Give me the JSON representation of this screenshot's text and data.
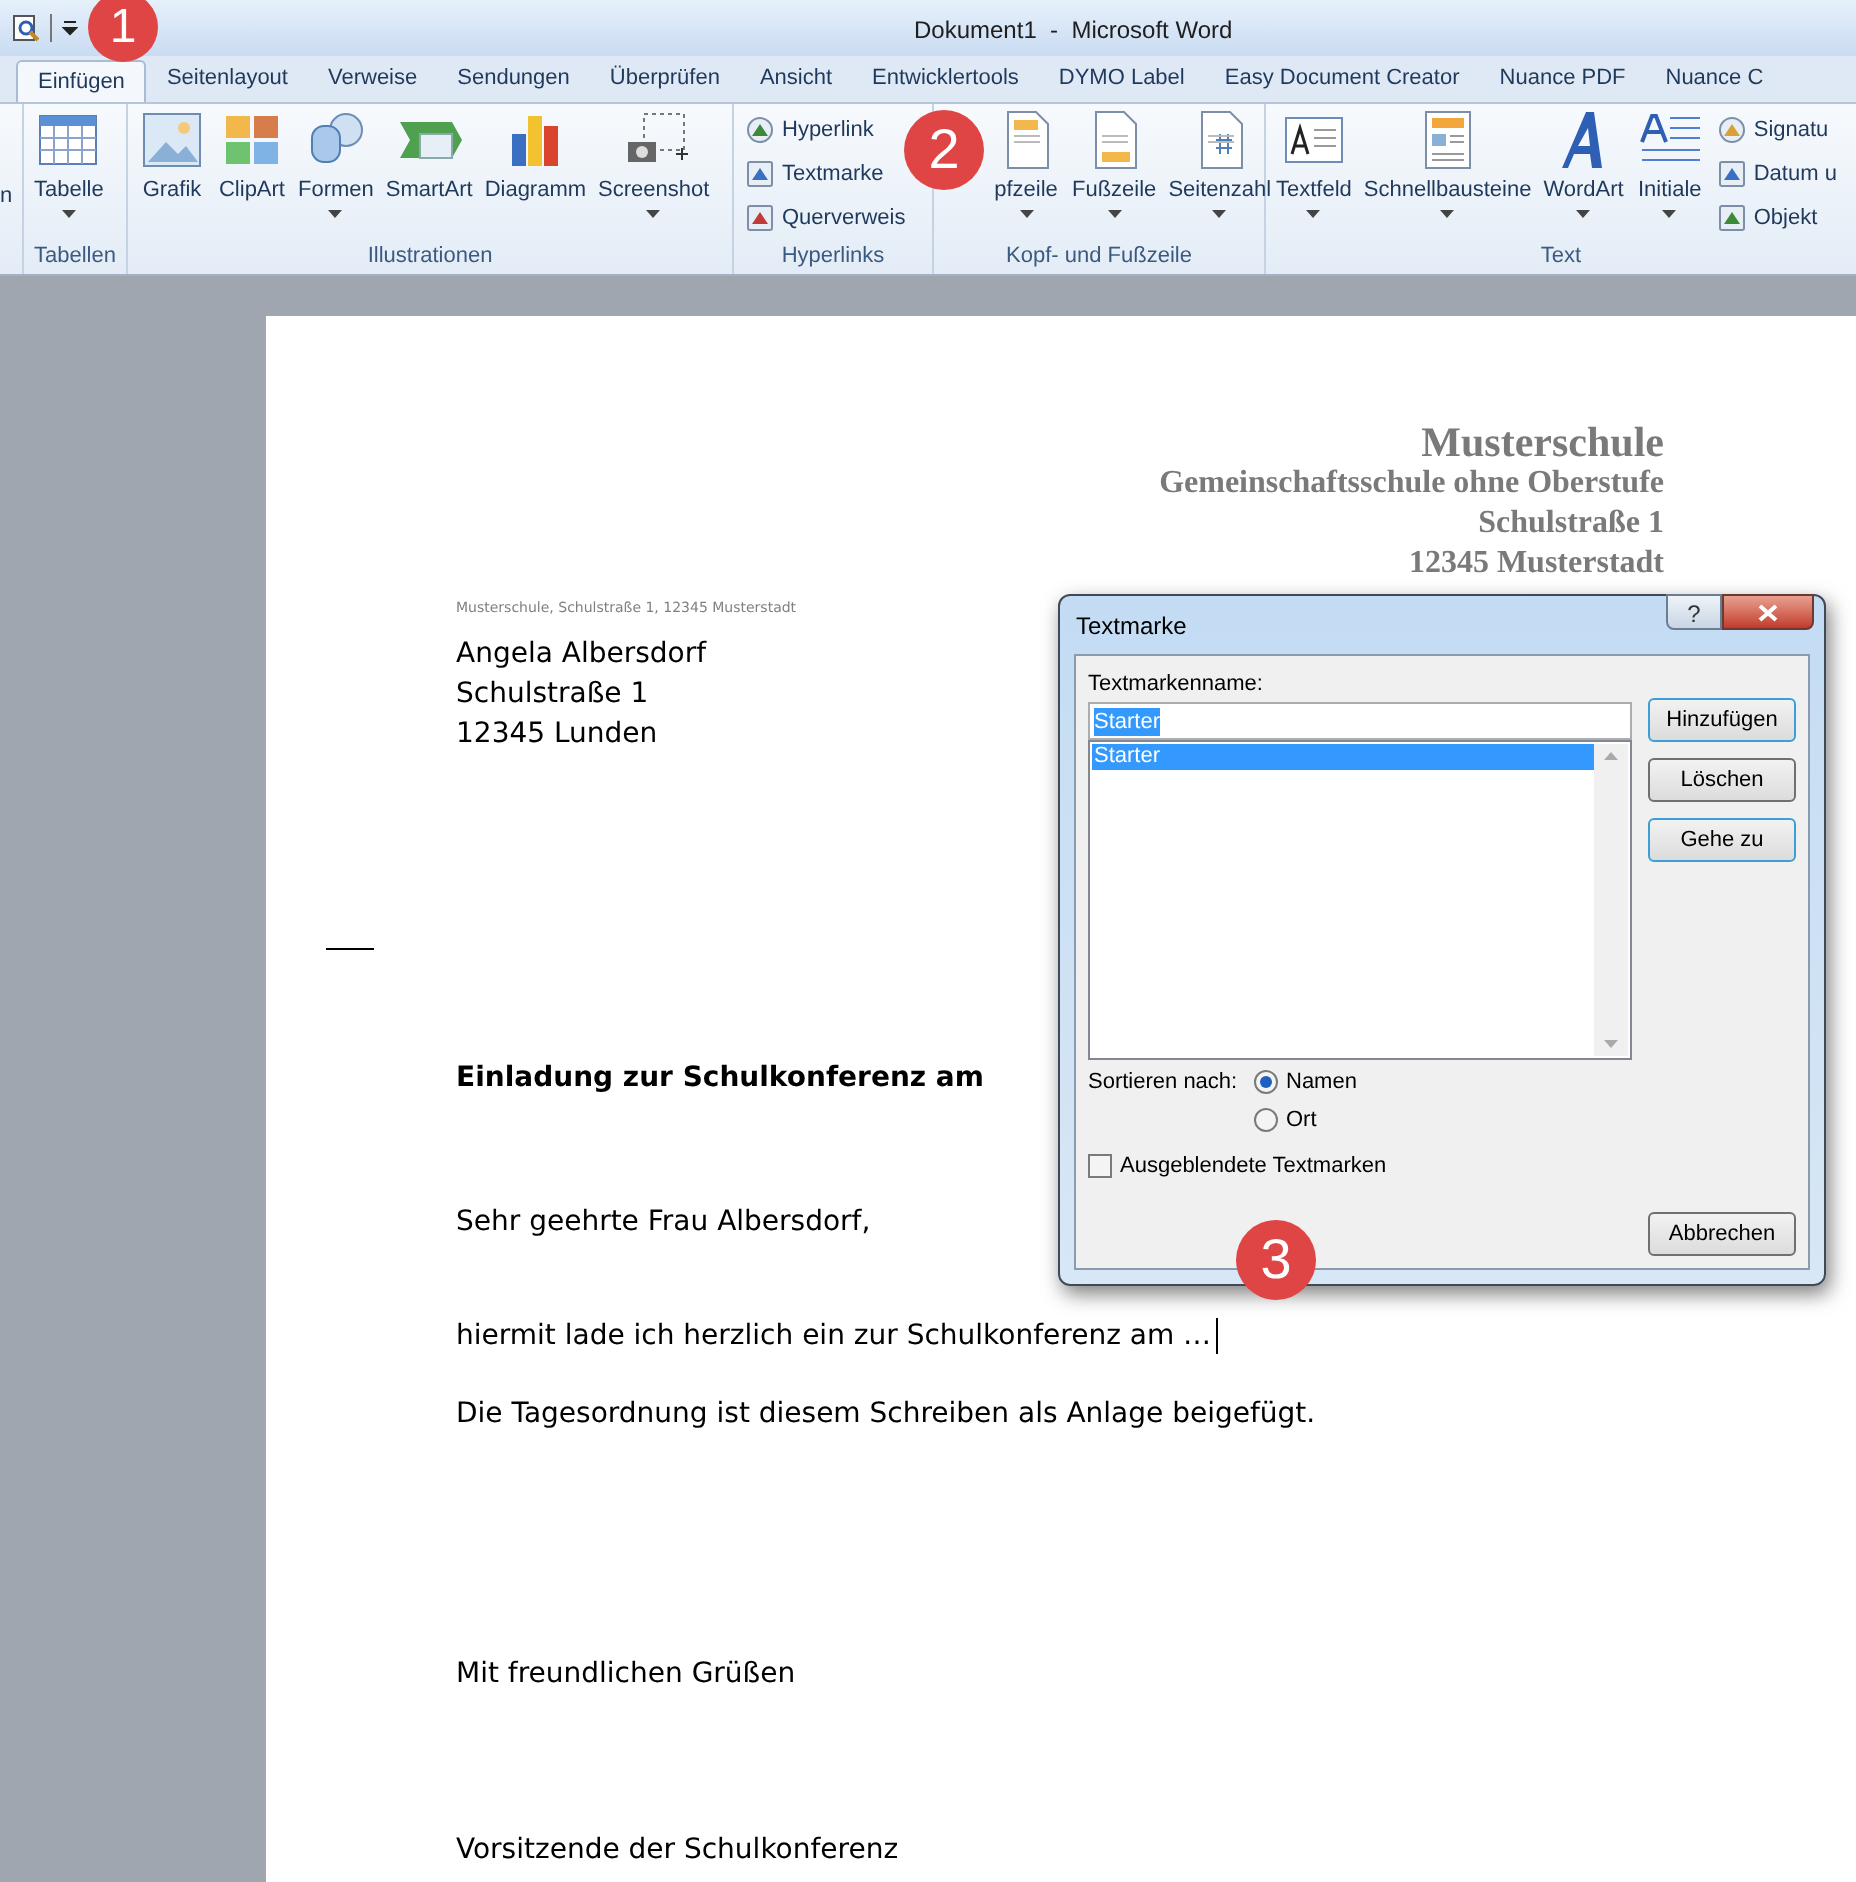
{
  "window": {
    "title": "Dokument1  -  Microsoft Word"
  },
  "tabs": [
    {
      "label": "Einfügen",
      "selected": true
    },
    {
      "label": "Seitenlayout",
      "selected": false
    },
    {
      "label": "Verweise",
      "selected": false
    },
    {
      "label": "Sendungen",
      "selected": false
    },
    {
      "label": "Überprüfen",
      "selected": false
    },
    {
      "label": "Ansicht",
      "selected": false
    },
    {
      "label": "Entwicklertools",
      "selected": false
    },
    {
      "label": "DYMO Label",
      "selected": false
    },
    {
      "label": "Easy Document Creator",
      "selected": false
    },
    {
      "label": "Nuance PDF",
      "selected": false
    },
    {
      "label": "Nuance C",
      "selected": false
    }
  ],
  "ribbon": {
    "cut_label": "n",
    "groups": [
      {
        "label": "Tabellen",
        "items": [
          {
            "kind": "large",
            "label": "Tabelle",
            "dropdown": true
          }
        ]
      },
      {
        "label": "Illustrationen",
        "items": [
          {
            "kind": "large",
            "label": "Grafik",
            "dropdown": false
          },
          {
            "kind": "large",
            "label": "ClipArt",
            "dropdown": false
          },
          {
            "kind": "large",
            "label": "Formen",
            "dropdown": true
          },
          {
            "kind": "large",
            "label": "SmartArt",
            "dropdown": false
          },
          {
            "kind": "large",
            "label": "Diagramm",
            "dropdown": false
          },
          {
            "kind": "large",
            "label": "Screenshot",
            "dropdown": true
          }
        ]
      },
      {
        "label": "Hyperlinks",
        "items": [
          {
            "kind": "stack",
            "labels": [
              "Hyperlink",
              "Textmarke",
              "Querverweis"
            ]
          }
        ]
      },
      {
        "label": "Kopf- und Fußzeile",
        "items": [
          {
            "kind": "large",
            "label": "pfzeile",
            "dropdown": true
          },
          {
            "kind": "large",
            "label": "Fußzeile",
            "dropdown": true
          },
          {
            "kind": "large",
            "label": "Seitenzahl",
            "dropdown": true
          }
        ]
      },
      {
        "label": "Text",
        "items": [
          {
            "kind": "large",
            "label": "Textfeld",
            "dropdown": true
          },
          {
            "kind": "large",
            "label": "Schnellbausteine",
            "dropdown": true
          },
          {
            "kind": "large",
            "label": "WordArt",
            "dropdown": true
          },
          {
            "kind": "large",
            "label": "Initiale",
            "dropdown": true
          },
          {
            "kind": "stack",
            "labels": [
              "Signatu",
              "Datum u",
              "Objekt"
            ]
          }
        ]
      }
    ]
  },
  "document": {
    "letterhead": [
      "Musterschule",
      "Gemeinschaftsschule ohne Oberstufe",
      "Schulstraße 1",
      "12345 Musterstadt"
    ],
    "sender_line": "Musterschule, Schulstraße 1, 12345 Musterstadt",
    "address": [
      "Angela Albersdorf",
      "Schulstraße 1",
      "12345 Lunden"
    ],
    "subject": "Einladung zur Schulkonferenz am",
    "greeting": "Sehr geehrte Frau Albersdorf,",
    "paragraphs": [
      "hiermit lade ich herzlich ein zur Schulkonferenz am …",
      "Die Tagesordnung ist diesem Schreiben als Anlage beigefügt."
    ],
    "closing": "Mit freundlichen Grüßen",
    "signature": "Vorsitzende der Schulkonferenz"
  },
  "dialog": {
    "title": "Textmarke",
    "help": "?",
    "field_label": "Textmarkenname:",
    "name_value": "Starter",
    "list": [
      {
        "label": "Starter",
        "selected": true
      }
    ],
    "sort_label": "Sortieren nach:",
    "sort_options": [
      {
        "label": "Namen",
        "selected": true
      },
      {
        "label": "Ort",
        "selected": false
      }
    ],
    "hidden_checkbox": {
      "label": "Ausgeblendete Textmarken",
      "checked": false
    },
    "buttons": [
      "Hinzufügen",
      "Löschen",
      "Gehe zu"
    ],
    "cancel": "Abbrechen"
  },
  "markers": [
    "1",
    "2",
    "3"
  ]
}
